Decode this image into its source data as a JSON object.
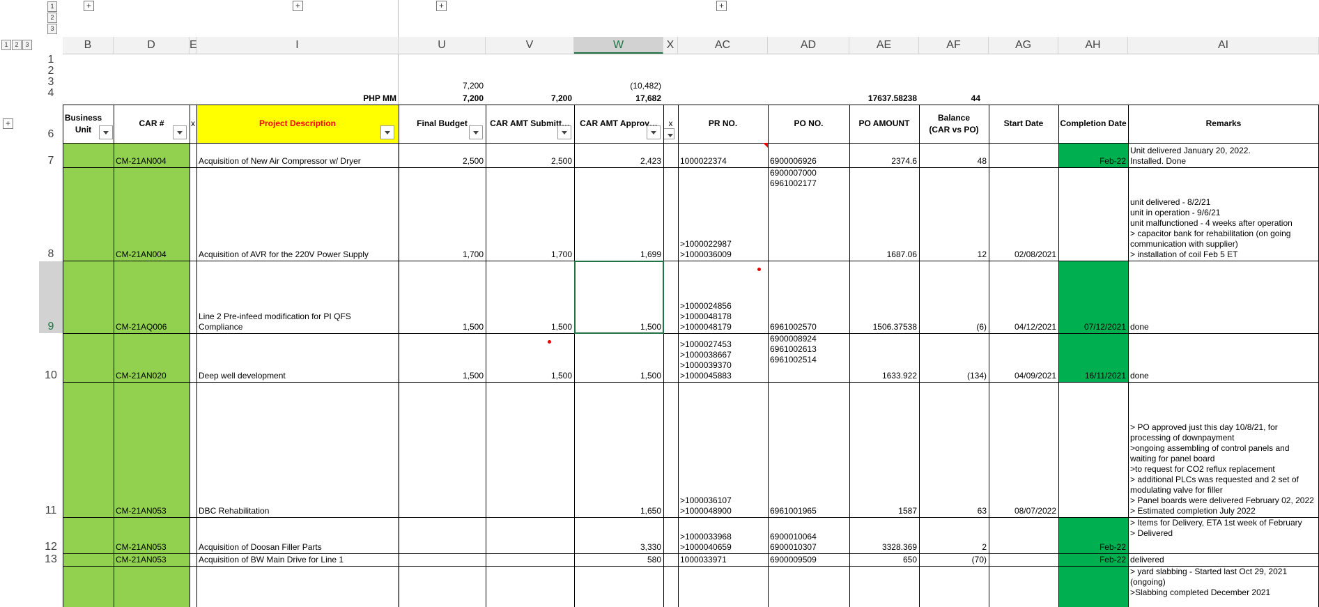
{
  "outline": {
    "row_levels": [
      "1",
      "2",
      "3"
    ],
    "col_levels": [
      "1",
      "2",
      "3"
    ],
    "expand_symbol": "+"
  },
  "columns": [
    "B",
    "D",
    "E",
    "I",
    "U",
    "V",
    "W",
    "X",
    "AC",
    "AD",
    "AE",
    "AF",
    "AG",
    "AH",
    "AI"
  ],
  "selected_column": "W",
  "rows": [
    "1",
    "2",
    "3",
    "4",
    "6",
    "7",
    "8",
    "9",
    "10",
    "11",
    "12",
    "13"
  ],
  "selected_row": "9",
  "top_values": {
    "u3": "7,200",
    "w3": "(10,482)",
    "i4": "PHP MM",
    "u4": "7,200",
    "v4": "7,200",
    "w4": "17,682",
    "ae4": "17637.58238",
    "af4": "44"
  },
  "headers": {
    "business_unit": "Business Unit",
    "car_no": "CAR #",
    "x1": "x",
    "project_description": "Project Description",
    "final_budget": "Final Budget",
    "car_amt_submitted": "CAR AMT Submitt…",
    "car_amt_approved": "CAR AMT Approv…",
    "x2": "x",
    "pr_no": "PR NO.",
    "po_no": "PO NO.",
    "po_amount": "PO AMOUNT",
    "balance_line1": "Balance",
    "balance_line2": "(CAR vs PO)",
    "start_date": "Start Date",
    "completion_date": "Completion Date",
    "remarks": "Remarks"
  },
  "data_rows": [
    {
      "car": "CM-21AN004",
      "desc": [
        "Acquisition of New Air Compressor w/ Dryer"
      ],
      "final_budget": "2,500",
      "submitted": "2,500",
      "approved": "2,423",
      "pr": [
        "1000022374"
      ],
      "po": [
        "6900006926"
      ],
      "po_amount": "2374.6",
      "balance": "48",
      "start": "",
      "completion": "Feb-22",
      "remarks": [
        "Unit delivered January 20, 2022.",
        "Installed. Done"
      ]
    },
    {
      "car": "CM-21AN004",
      "desc": [
        "Acquisition of AVR for the 220V Power Supply"
      ],
      "final_budget": "1,700",
      "submitted": "1,700",
      "approved": "1,699",
      "pr": [
        ">1000022987",
        ">1000036009"
      ],
      "po": [
        "6900007000",
        "6961002177"
      ],
      "po_amount": "1687.06",
      "balance": "12",
      "start": "02/08/2021",
      "completion": "",
      "remarks": [
        "unit delivered - 8/2/21",
        "unit in operation - 9/6/21",
        "unit malfunctioned - 4 weeks after operation",
        "> capacitor bank for rehabilitation (on going",
        "communication with supplier)",
        "> installation of coil Feb 5 ET"
      ]
    },
    {
      "car": "CM-21AQ006",
      "desc": [
        "Line 2 Pre-infeed modification for PI QFS",
        "Compliance"
      ],
      "final_budget": "1,500",
      "submitted": "1,500",
      "approved": "1,500",
      "pr": [
        ">1000024856",
        ">1000048178",
        ">1000048179"
      ],
      "po": [
        "6961002570"
      ],
      "po_amount": "1506.37538",
      "balance": "(6)",
      "start": "04/12/2021",
      "completion": "07/12/2021",
      "remarks": [
        "done"
      ]
    },
    {
      "car": "CM-21AN020",
      "desc": [
        "Deep well development"
      ],
      "final_budget": "1,500",
      "submitted": "1,500",
      "approved": "1,500",
      "pr": [
        ">1000027453",
        ">1000038667",
        ">1000039370",
        ">1000045883"
      ],
      "po": [
        "6900008924",
        "6961002613",
        "6961002514"
      ],
      "po_amount": "1633.922",
      "balance": "(134)",
      "start": "04/09/2021",
      "completion": "16/11/2021",
      "remarks": [
        "done"
      ]
    },
    {
      "car": "CM-21AN053",
      "desc": [
        "DBC Rehabilitation"
      ],
      "final_budget": "",
      "submitted": "",
      "approved": "1,650",
      "pr": [
        ">1000036107",
        ">1000048900"
      ],
      "po": [
        "6961001965"
      ],
      "po_amount": "1587",
      "balance": "63",
      "start": "08/07/2022",
      "completion": "",
      "remarks": [
        "> PO approved just this day 10/8/21, for",
        "processing of downpayment",
        ">ongoing assembling of control panels and",
        "waiting for panel board",
        ">to request for CO2 reflux replacement",
        "> additional PLCs was requested and 2 set of",
        "modulating valve for filler",
        "> Panel boards were delivered February 02, 2022",
        "> Estimated completion July 2022"
      ]
    },
    {
      "car": "CM-21AN053",
      "desc": [
        "Acquisition of Doosan Filler Parts"
      ],
      "final_budget": "",
      "submitted": "",
      "approved": "3,330",
      "pr": [
        ">1000033968",
        ">1000040659"
      ],
      "po": [
        "6900010064",
        "6900010307"
      ],
      "po_amount": "3328.369",
      "balance": "2",
      "start": "",
      "completion": "Feb-22",
      "remarks": [
        "> Items for Delivery, ETA 1st week of February",
        "> Delivered"
      ]
    },
    {
      "car": "CM-21AN053",
      "desc": [
        "Acquisition of BW Main Drive for Line 1"
      ],
      "final_budget": "",
      "submitted": "",
      "approved": "580",
      "pr": [
        "1000033971"
      ],
      "po": [
        "6900009509"
      ],
      "po_amount": "650",
      "balance": "(70)",
      "start": "",
      "completion": "Feb-22",
      "remarks": [
        "delivered"
      ]
    },
    {
      "car": "",
      "desc": [],
      "final_budget": "",
      "submitted": "",
      "approved": "",
      "pr": [],
      "po": [],
      "po_amount": "",
      "balance": "",
      "start": "",
      "completion": "",
      "remarks": [
        "> yard slabbing - Started last Oct 29, 2021",
        "(ongoing)",
        ">Slabbing completed December 2021"
      ]
    }
  ],
  "colors": {
    "unit_green": "#92d050",
    "done_green": "#00b050",
    "header_yellow": "#ffff00",
    "header_red_text": "#ff0000",
    "selection": "#217346"
  }
}
